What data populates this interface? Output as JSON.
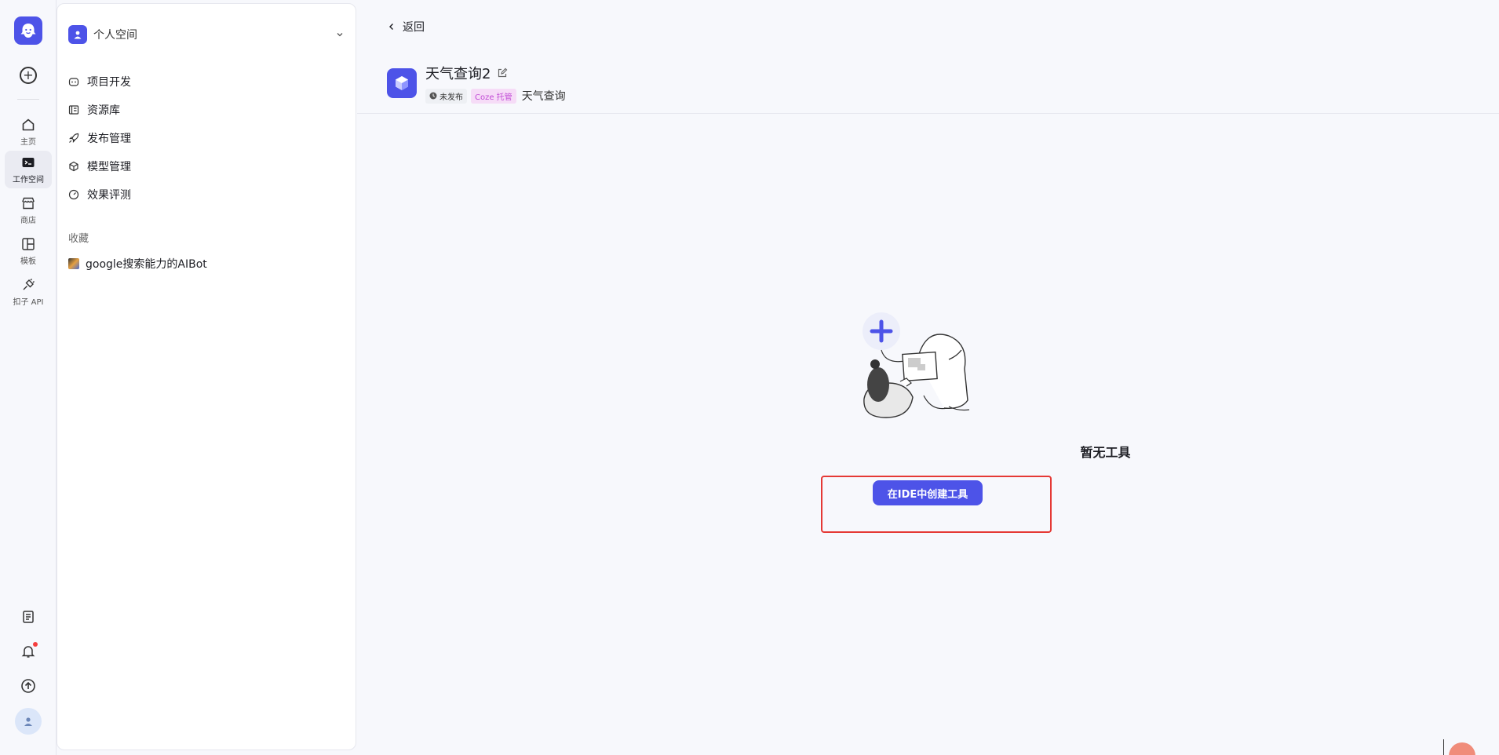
{
  "rail": {
    "items": [
      {
        "label": "主页",
        "icon": "home-icon"
      },
      {
        "label": "工作空间",
        "icon": "terminal-folder-icon"
      },
      {
        "label": "商店",
        "icon": "store-icon"
      },
      {
        "label": "模板",
        "icon": "template-icon"
      },
      {
        "label": "扣子 API",
        "icon": "plug-icon"
      }
    ],
    "active": "工作空间"
  },
  "panel": {
    "space_name": "个人空间",
    "nav": [
      {
        "label": "项目开发",
        "icon": "robot-icon"
      },
      {
        "label": "资源库",
        "icon": "library-icon"
      },
      {
        "label": "发布管理",
        "icon": "rocket-icon"
      },
      {
        "label": "模型管理",
        "icon": "cube-icon"
      },
      {
        "label": "效果评测",
        "icon": "gauge-icon"
      }
    ],
    "favorites_title": "收藏",
    "favorites": [
      {
        "label": "google搜索能力的AIBot"
      }
    ]
  },
  "main": {
    "back_label": "返回",
    "project_title": "天气查询2",
    "status_tag": "未发布",
    "host_tag": "Coze 托管",
    "description": "天气查询",
    "empty_title": "暂无工具",
    "create_button": "在IDE中创建工具"
  },
  "colors": {
    "accent": "#4d53e8",
    "highlight": "#e53935",
    "host_tag_text": "#c14bd6"
  }
}
